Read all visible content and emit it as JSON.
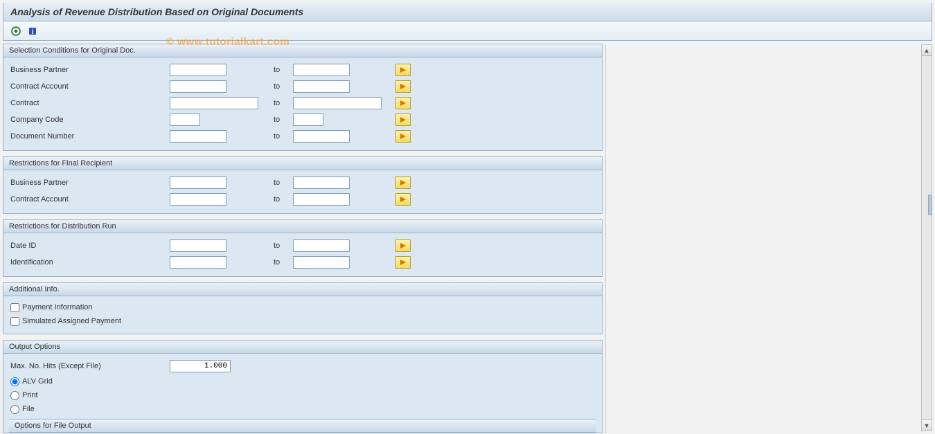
{
  "title": "Analysis of Revenue Distribution Based on Original Documents",
  "watermark": "© www.tutorialkart.com",
  "toolbar": {
    "execute_name": "execute",
    "info_name": "info"
  },
  "groups": {
    "sel": {
      "title": "Selection Conditions for Original Doc.",
      "rows": {
        "bp": {
          "label": "Business Partner",
          "to": "to"
        },
        "ca": {
          "label": "Contract Account",
          "to": "to"
        },
        "ct": {
          "label": "Contract",
          "to": "to"
        },
        "cc": {
          "label": "Company Code",
          "to": "to"
        },
        "dn": {
          "label": "Document Number",
          "to": "to"
        }
      }
    },
    "recip": {
      "title": "Restrictions for Final Recipient",
      "rows": {
        "bp": {
          "label": "Business Partner",
          "to": "to"
        },
        "ca": {
          "label": "Contract Account",
          "to": "to"
        }
      }
    },
    "run": {
      "title": "Restrictions for Distribution Run",
      "rows": {
        "dateid": {
          "label": "Date ID",
          "to": "to"
        },
        "ident": {
          "label": "Identification",
          "to": "to"
        }
      }
    },
    "add": {
      "title": "Additional Info.",
      "checks": {
        "payinfo": "Payment Information",
        "simpay": "Simulated Assigned Payment"
      }
    },
    "out": {
      "title": "Output Options",
      "maxhits_label": "Max. No. Hits (Except File)",
      "maxhits_value": "1.000",
      "radios": {
        "alv": "ALV Grid",
        "print": "Print",
        "file": "File"
      },
      "fileopts_title": "Options for File Output"
    }
  }
}
